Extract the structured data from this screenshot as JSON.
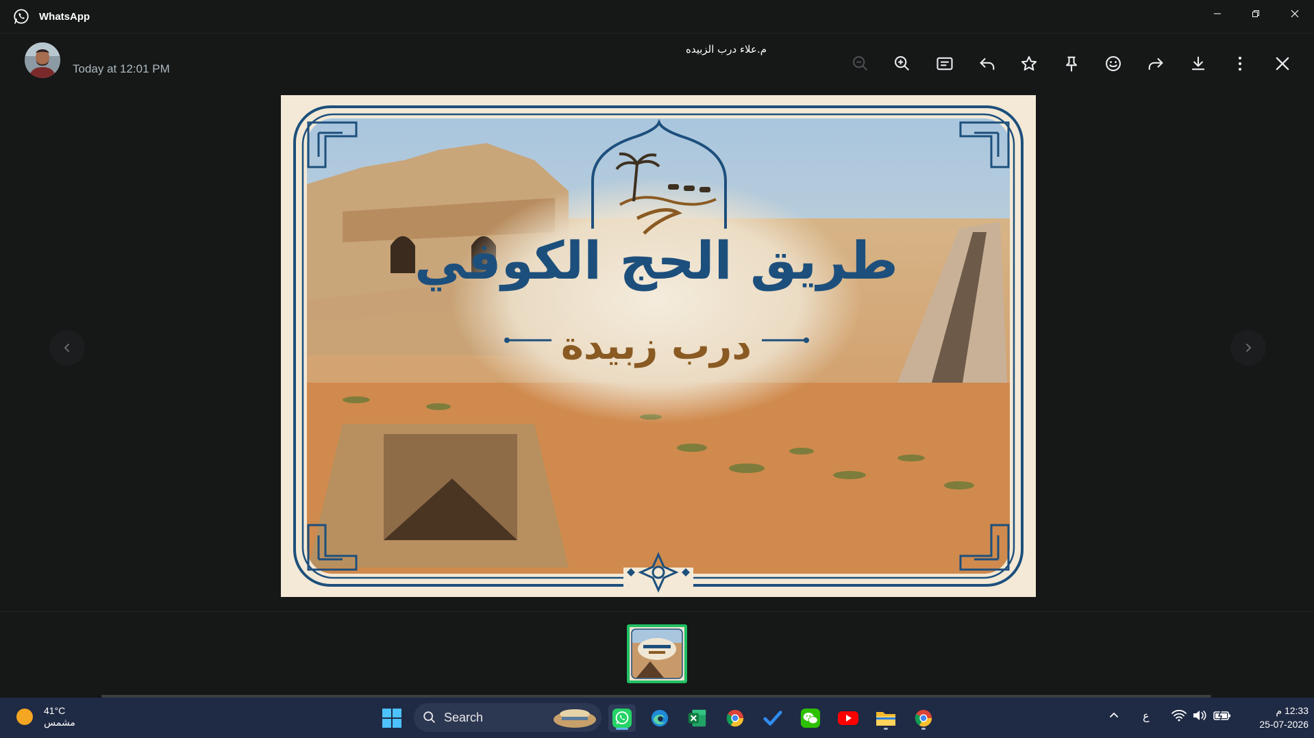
{
  "window": {
    "title": "WhatsApp"
  },
  "viewer": {
    "sender": "م.علاء درب الزبيده",
    "timestamp": "Today at 12:01 PM",
    "tools": [
      "zoom-out",
      "zoom-in",
      "caption",
      "reply",
      "star",
      "pin",
      "react",
      "forward",
      "download",
      "more",
      "close"
    ]
  },
  "image": {
    "title": "طريق الحج الكوفي",
    "subtitle": "درب زبيدة"
  },
  "taskbar": {
    "weather_temp": "41°C",
    "weather_desc": "مشمس",
    "search_label": "Search",
    "language": "ع",
    "time": "12:33 م",
    "date": "25-07-2026"
  },
  "colors": {
    "accent": "#21c063",
    "frame_blue": "#1d4f7c",
    "title_blue": "#1d4f7c",
    "subtitle_brown": "#8a5a23"
  }
}
